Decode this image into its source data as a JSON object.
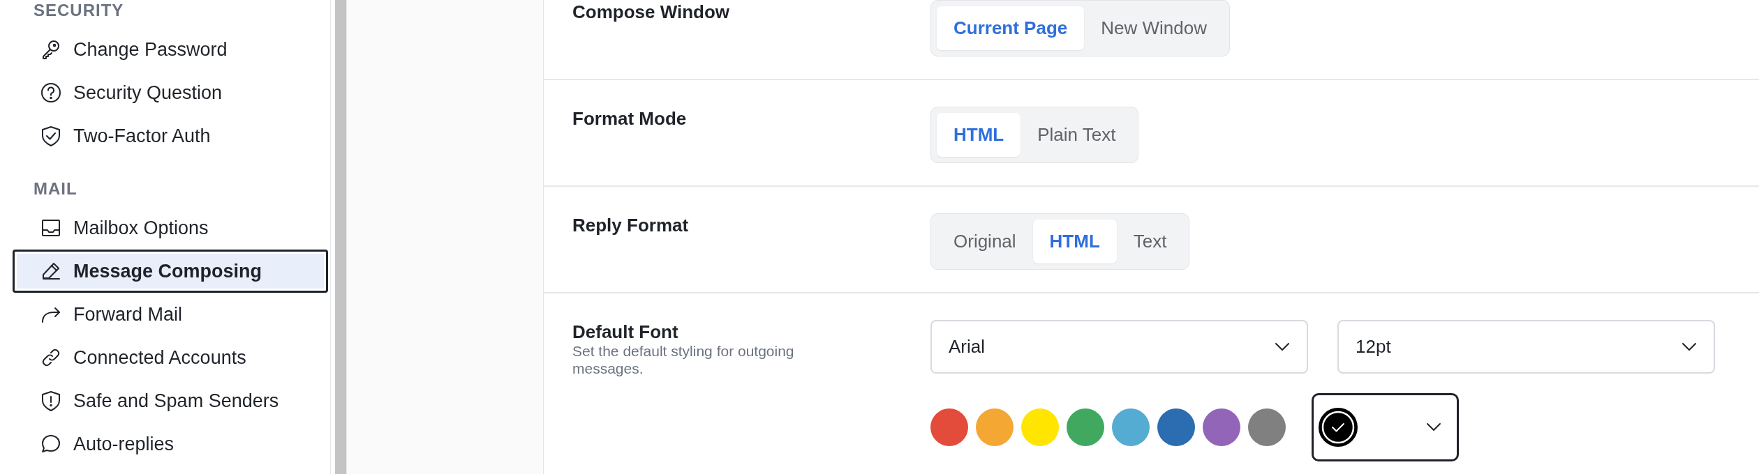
{
  "sidebar": {
    "sections": [
      {
        "heading": "SECURITY",
        "items": [
          {
            "label": "Change Password",
            "selected": false
          },
          {
            "label": "Security Question",
            "selected": false
          },
          {
            "label": "Two-Factor Auth",
            "selected": false
          }
        ]
      },
      {
        "heading": "MAIL",
        "items": [
          {
            "label": "Mailbox Options",
            "selected": false
          },
          {
            "label": "Message Composing",
            "selected": true
          },
          {
            "label": "Forward Mail",
            "selected": false
          },
          {
            "label": "Connected Accounts",
            "selected": false
          },
          {
            "label": "Safe and Spam Senders",
            "selected": false
          },
          {
            "label": "Auto-replies",
            "selected": false
          }
        ]
      }
    ]
  },
  "settings": [
    {
      "kind": "segmented",
      "label": "Compose Window",
      "options": [
        {
          "label": "Current Page",
          "selected": true
        },
        {
          "label": "New Window",
          "selected": false
        }
      ]
    },
    {
      "kind": "segmented",
      "label": "Format Mode",
      "options": [
        {
          "label": "HTML",
          "selected": true
        },
        {
          "label": "Plain Text",
          "selected": false
        }
      ]
    },
    {
      "kind": "segmented",
      "label": "Reply Format",
      "options": [
        {
          "label": "Original",
          "selected": false
        },
        {
          "label": "HTML",
          "selected": true
        },
        {
          "label": "Text",
          "selected": false
        }
      ]
    },
    {
      "kind": "font",
      "label": "Default Font",
      "description": "Set the default styling for outgoing messages.",
      "font": "Arial",
      "size": "12pt",
      "swatches": [
        {
          "color": "#e34b3a"
        },
        {
          "color": "#f4a733"
        },
        {
          "color": "#ffe500"
        },
        {
          "color": "#41a85f"
        },
        {
          "color": "#54acd2"
        },
        {
          "color": "#2c6cb0"
        },
        {
          "color": "#9365b8"
        },
        {
          "color": "#808080"
        }
      ],
      "text_color": {
        "color": "#000000"
      }
    }
  ]
}
